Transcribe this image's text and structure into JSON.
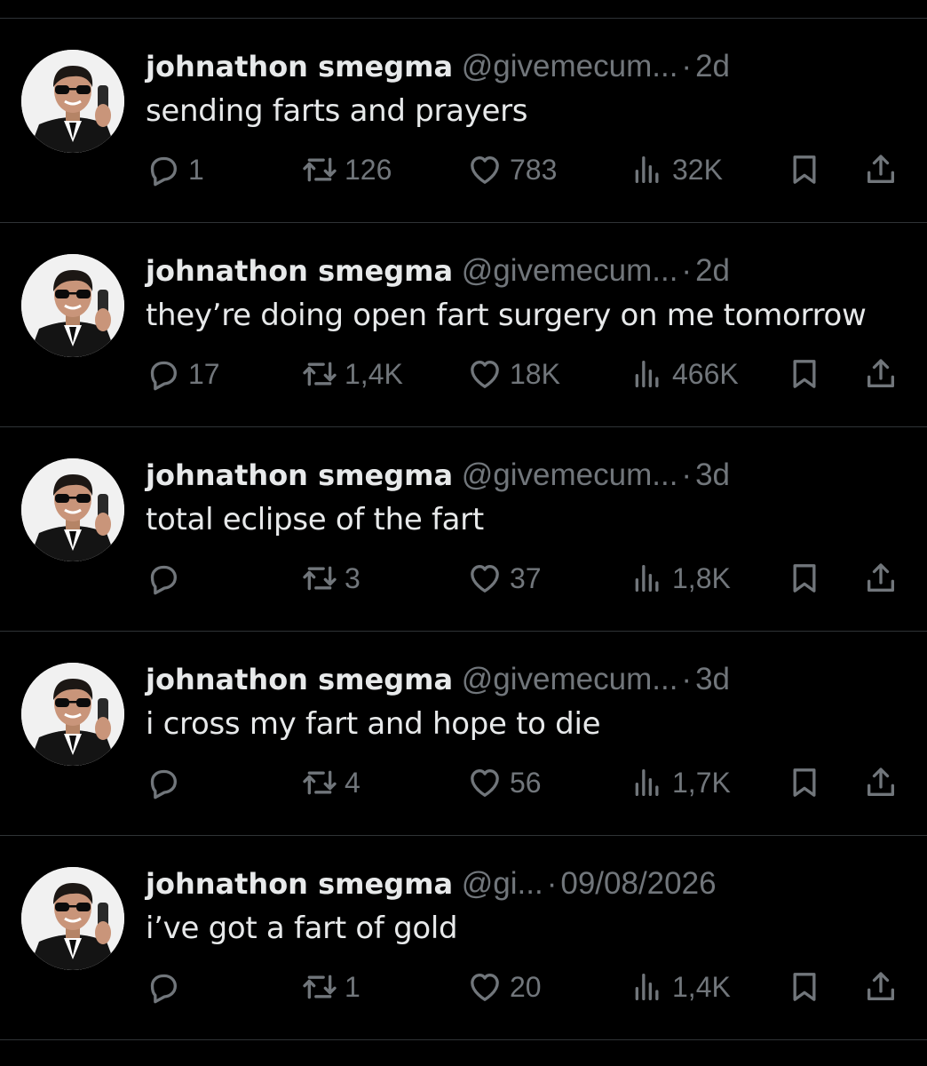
{
  "tweets": [
    {
      "name": "johnathon smegma",
      "handle": "@givemecum...",
      "time": "2d",
      "text": "sending farts and prayers",
      "replies": "1",
      "retweets": "126",
      "likes": "783",
      "views": "32K"
    },
    {
      "name": "johnathon smegma",
      "handle": "@givemecum...",
      "time": "2d",
      "text": "they’re doing open fart surgery on me tomorrow",
      "replies": "17",
      "retweets": "1,4K",
      "likes": "18K",
      "views": "466K"
    },
    {
      "name": "johnathon smegma",
      "handle": "@givemecum...",
      "time": "3d",
      "text": "total eclipse of the fart",
      "replies": "",
      "retweets": "3",
      "likes": "37",
      "views": "1,8K"
    },
    {
      "name": "johnathon smegma",
      "handle": "@givemecum...",
      "time": "3d",
      "text": "i cross my fart and hope to die",
      "replies": "",
      "retweets": "4",
      "likes": "56",
      "views": "1,7K"
    },
    {
      "name": "johnathon smegma",
      "handle": "@gi...",
      "time": "09/08/2026",
      "text": "i’ve got a fart of gold",
      "replies": "",
      "retweets": "1",
      "likes": "20",
      "views": "1,4K"
    }
  ],
  "header_separator": "·",
  "icons": {
    "reply": "reply-bubble-icon",
    "retweet": "retweet-icon",
    "like": "heart-icon",
    "views": "views-bar-chart-icon",
    "bookmark": "bookmark-icon",
    "share": "share-upload-icon"
  },
  "colors": {
    "background": "#000000",
    "primary_text": "#e7e9ea",
    "secondary_text": "#71767b",
    "divider": "#2f3336"
  }
}
